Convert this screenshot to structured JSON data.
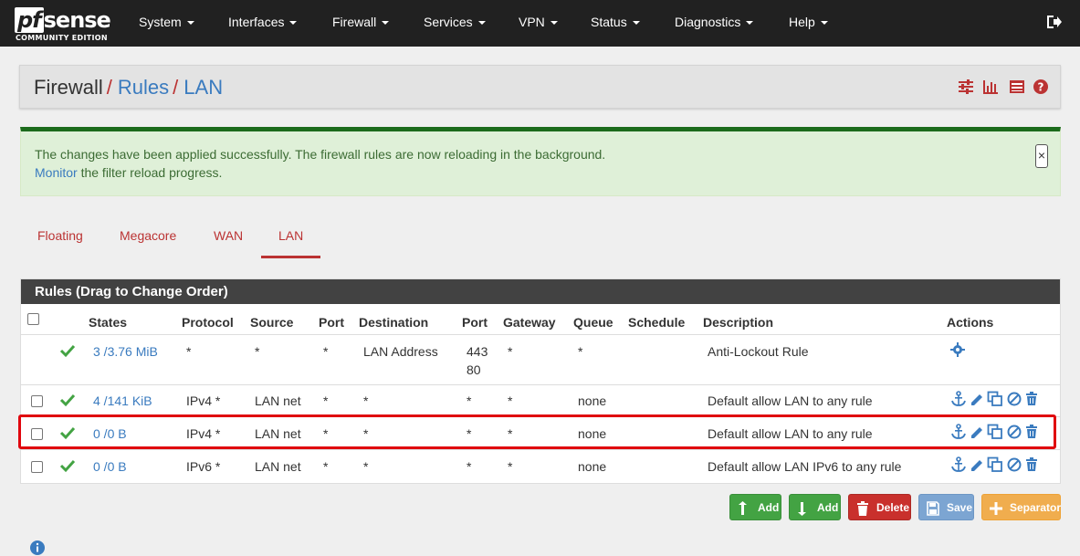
{
  "app": {
    "logo_main_pf": "pf",
    "logo_main_sense": "sense",
    "logo_sub": "COMMUNITY EDITION"
  },
  "nav": {
    "items": [
      {
        "label": "System"
      },
      {
        "label": "Interfaces"
      },
      {
        "label": "Firewall"
      },
      {
        "label": "Services"
      },
      {
        "label": "VPN"
      },
      {
        "label": "Status"
      },
      {
        "label": "Diagnostics"
      },
      {
        "label": "Help"
      }
    ],
    "logout_icon": "sign-out-icon"
  },
  "breadcrumb": {
    "part1": "Firewall",
    "separator": "/",
    "part2": "Rules",
    "part3": "LAN",
    "icons": [
      "sliders-icon",
      "bar-chart-icon",
      "list-alt-icon",
      "question-circle-icon"
    ]
  },
  "alert": {
    "line1": "The changes have been applied successfully. The firewall rules are now reloading in the background.",
    "monitor_link": "Monitor",
    "line2_rest": " the filter reload progress.",
    "close_label": "×"
  },
  "tabs": [
    {
      "label": "Floating",
      "active": false
    },
    {
      "label": "Megacore",
      "active": false
    },
    {
      "label": "WAN",
      "active": false
    },
    {
      "label": "LAN",
      "active": true
    }
  ],
  "rules_panel": {
    "title": "Rules (Drag to Change Order)",
    "columns": [
      "States",
      "Protocol",
      "Source",
      "Port",
      "Destination",
      "Port",
      "Gateway",
      "Queue",
      "Schedule",
      "Description",
      "Actions"
    ],
    "rows": [
      {
        "states": "3 /3.76 MiB",
        "protocol": "*",
        "source": "*",
        "sport": "*",
        "destination": "LAN Address",
        "dport_1": "443",
        "dport_2": "80",
        "gateway": "*",
        "queue": "*",
        "schedule": "",
        "description": "Anti-Lockout Rule",
        "has_checkbox": false
      },
      {
        "states": "4 /141 KiB",
        "protocol": "IPv4 *",
        "source": "LAN net",
        "sport": "*",
        "destination": "*",
        "dport": "*",
        "gateway": "*",
        "queue": "none",
        "schedule": "",
        "description": "Default allow LAN to any rule",
        "has_checkbox": true
      },
      {
        "states": "0 /0 B",
        "protocol": "IPv4 *",
        "source": "LAN net",
        "sport": "*",
        "destination": "*",
        "dport": "*",
        "gateway": "*",
        "queue": "none",
        "schedule": "",
        "description": "Default allow LAN to any rule",
        "has_checkbox": true,
        "highlighted": true
      },
      {
        "states": "0 /0 B",
        "protocol": "IPv6 *",
        "source": "LAN net",
        "sport": "*",
        "destination": "*",
        "dport": "*",
        "gateway": "*",
        "queue": "none",
        "schedule": "",
        "description": "Default allow LAN IPv6 to any rule",
        "has_checkbox": true
      }
    ]
  },
  "buttons": {
    "add_top": "Add",
    "add_bottom": "Add",
    "delete": "Delete",
    "save": "Save",
    "separator": "Separator"
  },
  "colors": {
    "accent_red": "#b33333",
    "link_blue": "#3a7bbf",
    "success_green": "#43a343",
    "highlight_red": "#e0060e"
  }
}
